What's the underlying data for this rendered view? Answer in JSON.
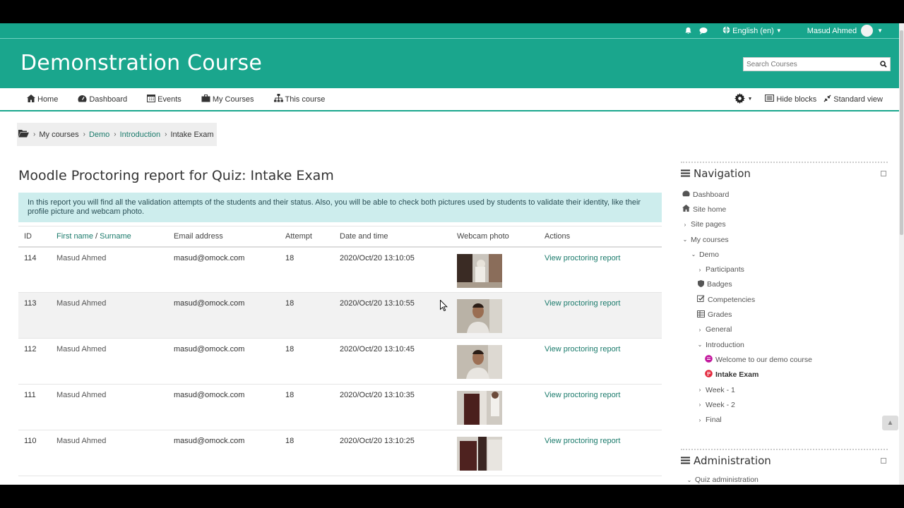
{
  "topbar": {
    "language": "English (en)",
    "user_name": "Masud Ahmed",
    "icons": [
      "bell-icon",
      "chat-icon",
      "globe-icon"
    ]
  },
  "header": {
    "title": "Demonstration Course",
    "search_placeholder": "Search Courses"
  },
  "navbar": {
    "items": [
      {
        "label": "Home",
        "icon": "home-icon"
      },
      {
        "label": "Dashboard",
        "icon": "dashboard-icon"
      },
      {
        "label": "Events",
        "icon": "calendar-icon"
      },
      {
        "label": "My Courses",
        "icon": "briefcase-icon"
      },
      {
        "label": "This course",
        "icon": "sitemap-icon"
      }
    ],
    "hide_blocks": "Hide blocks",
    "standard_view": "Standard view"
  },
  "breadcrumb": [
    "My courses",
    "Demo",
    "Introduction",
    "Intake Exam"
  ],
  "main": {
    "title": "Moodle Proctoring report for Quiz: Intake Exam",
    "info": "In this report you will find all the validation attempts of the students and their status. Also, you will be able to check both pictures used by students to validate their identity, like their profile picture and webcam photo.",
    "columns": {
      "id": "ID",
      "first_name": "First name",
      "surname_sep": " / ",
      "surname": "Surname",
      "email": "Email address",
      "attempt": "Attempt",
      "date": "Date and time",
      "photo": "Webcam photo",
      "actions": "Actions"
    },
    "rows": [
      {
        "id": "114",
        "name": "Masud Ahmed",
        "email": "masud@omock.com",
        "attempt": "18",
        "date": "2020/Oct/20 13:10:05",
        "action": "View proctoring report"
      },
      {
        "id": "113",
        "name": "Masud Ahmed",
        "email": "masud@omock.com",
        "attempt": "18",
        "date": "2020/Oct/20 13:10:55",
        "action": "View proctoring report"
      },
      {
        "id": "112",
        "name": "Masud Ahmed",
        "email": "masud@omock.com",
        "attempt": "18",
        "date": "2020/Oct/20 13:10:45",
        "action": "View proctoring report"
      },
      {
        "id": "111",
        "name": "Masud Ahmed",
        "email": "masud@omock.com",
        "attempt": "18",
        "date": "2020/Oct/20 13:10:35",
        "action": "View proctoring report"
      },
      {
        "id": "110",
        "name": "Masud Ahmed",
        "email": "masud@omock.com",
        "attempt": "18",
        "date": "2020/Oct/20 13:10:25",
        "action": "View proctoring report"
      }
    ]
  },
  "navigation": {
    "title": "Navigation",
    "items": [
      {
        "label": "Dashboard",
        "icon": "dashboard-icon"
      },
      {
        "label": "Site home",
        "icon": "home-icon"
      },
      {
        "label": "Site pages",
        "icon": "chevron-right-icon"
      },
      {
        "label": "My courses",
        "icon": "chevron-down-icon"
      },
      {
        "label": "Demo",
        "icon": "chevron-down-icon"
      },
      {
        "label": "Participants",
        "icon": "chevron-right-icon"
      },
      {
        "label": "Badges",
        "icon": "badge-icon"
      },
      {
        "label": "Competencies",
        "icon": "check-square-icon"
      },
      {
        "label": "Grades",
        "icon": "table-icon"
      },
      {
        "label": "General",
        "icon": "chevron-right-icon"
      },
      {
        "label": "Introduction",
        "icon": "chevron-down-icon"
      },
      {
        "label": "Welcome to our demo course",
        "icon": "forum-icon"
      },
      {
        "label": "Intake Exam",
        "icon": "quiz-icon"
      },
      {
        "label": "Week - 1",
        "icon": "chevron-right-icon"
      },
      {
        "label": "Week - 2",
        "icon": "chevron-right-icon"
      },
      {
        "label": "Final",
        "icon": "chevron-right-icon"
      }
    ]
  },
  "administration": {
    "title": "Administration",
    "first_item": "Quiz administration"
  }
}
